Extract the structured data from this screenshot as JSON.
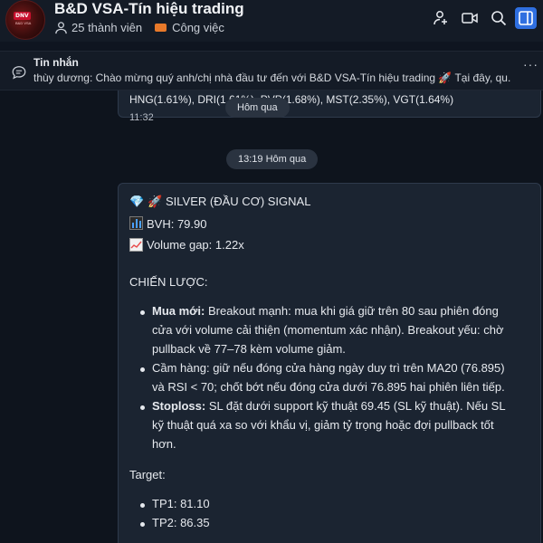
{
  "header": {
    "avatar_text": "DNV",
    "avatar_sub": "B&D VSA",
    "title": "B&D VSA-Tín hiệu trading",
    "members": "25 thành viên",
    "tag": "Công việc",
    "icons": [
      "add-member-icon",
      "video-icon",
      "search-icon",
      "sidebar-panel-icon"
    ],
    "accent": "#2f6fe0"
  },
  "pinned": {
    "title": "Tin nhắn",
    "text": "thùy dương: Chào mừng quý anh/chị nhà đầu tư đến với B&D VSA-Tín hiệu trading 🚀 Tại đây,  qu...",
    "more": "···"
  },
  "chat": {
    "prev_message": {
      "text": "HNG(1.61%), DRI(1.61%), PVP(1.68%), MST(2.35%), VGT(1.64%)",
      "time": "11:32"
    },
    "floating_pill": "Hôm qua",
    "date_pill": "13:19 Hôm qua",
    "message": {
      "title": "SILVER (ĐẦU CƠ) SIGNAL",
      "bvh": "BVH: 79.90",
      "volume_gap": "Volume gap: 1.22x",
      "strategy_heading": "CHIẾN LƯỢC:",
      "bullets": [
        {
          "bold": "Mua mới:",
          "lines": [
            " Breakout mạnh: mua khi giá giữ trên 80 sau phiên đóng",
            "cửa với volume cải thiện (momentum xác nhận). Breakout yếu: chờ",
            "pullback về 77–78 kèm volume giảm."
          ]
        },
        {
          "bold": "",
          "lines": [
            "Cầm hàng: giữ nếu đóng cửa hàng ngày duy trì trên MA20 (76.895)",
            "và RSI < 70; chốt bớt nếu đóng cửa dưới 76.895 hai phiên liên tiếp."
          ]
        },
        {
          "bold": "Stoploss:",
          "lines": [
            " SL đặt dưới support kỹ thuật 69.45 (SL kỹ thuật). Nếu SL",
            "kỹ thuật quá xa so với khẩu vị, giảm tỷ trọng hoặc đợi pullback tốt",
            "hơn."
          ]
        }
      ],
      "target_heading": "Target:",
      "targets": [
        "TP1: 81.10",
        "TP2: 86.35"
      ]
    }
  }
}
